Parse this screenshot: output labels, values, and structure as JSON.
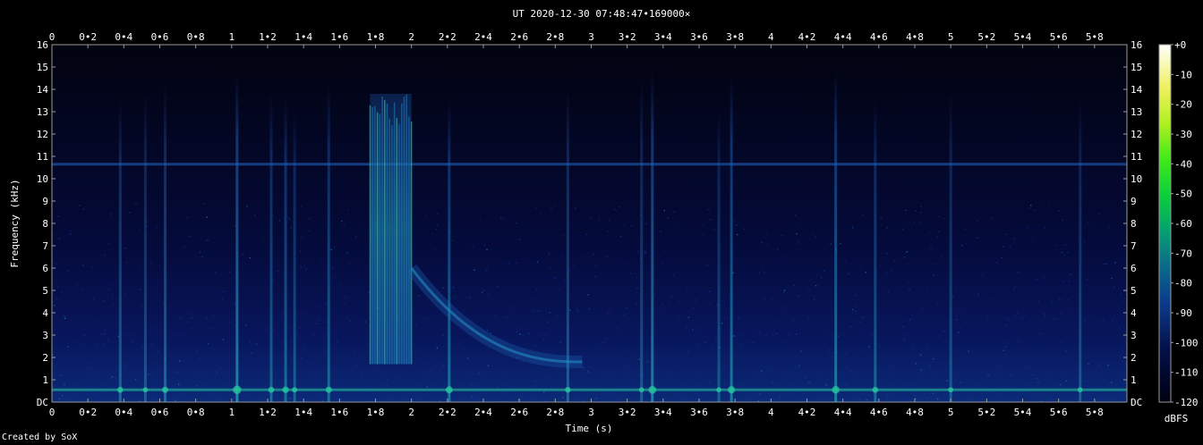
{
  "chart_data": {
    "type": "heatmap",
    "title": "UT 2020-12-30 07:48:47•169000×",
    "xlabel": "Time (s)",
    "ylabel": "Frequency (kHz)",
    "xlim": [
      0,
      5.98
    ],
    "ylim": [
      0,
      16
    ],
    "x_ticks": [
      "0",
      "0•2",
      "0•4",
      "0•6",
      "0•8",
      "1",
      "1•2",
      "1•4",
      "1•6",
      "1•8",
      "2",
      "2•2",
      "2•4",
      "2•6",
      "2•8",
      "3",
      "3•2",
      "3•4",
      "3•6",
      "3•8",
      "4",
      "4•2",
      "4•4",
      "4•6",
      "4•8",
      "5",
      "5•2",
      "5•4",
      "5•6",
      "5•8"
    ],
    "y_ticks": [
      "DC",
      "1",
      "2",
      "3",
      "4",
      "5",
      "6",
      "7",
      "8",
      "9",
      "10",
      "11",
      "12",
      "13",
      "14",
      "15",
      "16"
    ],
    "colorbar": {
      "label": "dBFS",
      "ticks": [
        "+0",
        "-10",
        "-20",
        "-30",
        "-40",
        "-50",
        "-60",
        "-70",
        "-80",
        "-90",
        "-100",
        "-110",
        "-120"
      ],
      "range": [
        -120,
        0
      ]
    },
    "features": {
      "tone_khz": [
        0.55,
        10.65
      ],
      "sferics": [
        {
          "t": 0.38,
          "f_top": 13.5,
          "intensity": 0.45
        },
        {
          "t": 0.52,
          "f_top": 13.8,
          "intensity": 0.3
        },
        {
          "t": 0.63,
          "f_top": 14.2,
          "intensity": 0.5
        },
        {
          "t": 1.03,
          "f_top": 14.7,
          "intensity": 0.9
        },
        {
          "t": 1.22,
          "f_top": 13.8,
          "intensity": 0.45
        },
        {
          "t": 1.3,
          "f_top": 13.6,
          "intensity": 0.55
        },
        {
          "t": 1.35,
          "f_top": 13.0,
          "intensity": 0.35
        },
        {
          "t": 1.54,
          "f_top": 14.2,
          "intensity": 0.5
        },
        {
          "t": 2.21,
          "f_top": 13.5,
          "intensity": 0.65
        },
        {
          "t": 2.87,
          "f_top": 14.0,
          "intensity": 0.4
        },
        {
          "t": 3.28,
          "f_top": 14.5,
          "intensity": 0.3
        },
        {
          "t": 3.34,
          "f_top": 14.8,
          "intensity": 0.8
        },
        {
          "t": 3.78,
          "f_top": 14.6,
          "intensity": 0.7
        },
        {
          "t": 3.71,
          "f_top": 13.0,
          "intensity": 0.3
        },
        {
          "t": 4.36,
          "f_top": 14.8,
          "intensity": 0.75
        },
        {
          "t": 4.58,
          "f_top": 13.5,
          "intensity": 0.45
        },
        {
          "t": 5.0,
          "f_top": 13.8,
          "intensity": 0.3
        },
        {
          "t": 5.72,
          "f_top": 13.5,
          "intensity": 0.3
        }
      ],
      "burst": {
        "t_start": 1.77,
        "t_end": 2.0,
        "f_low": 1.7,
        "f_high": 13.8
      },
      "whistler": {
        "t_start": 2.0,
        "t_end": 2.95,
        "f_start": 6.0,
        "f_end": 1.8
      }
    }
  },
  "credit": "Created by SoX"
}
